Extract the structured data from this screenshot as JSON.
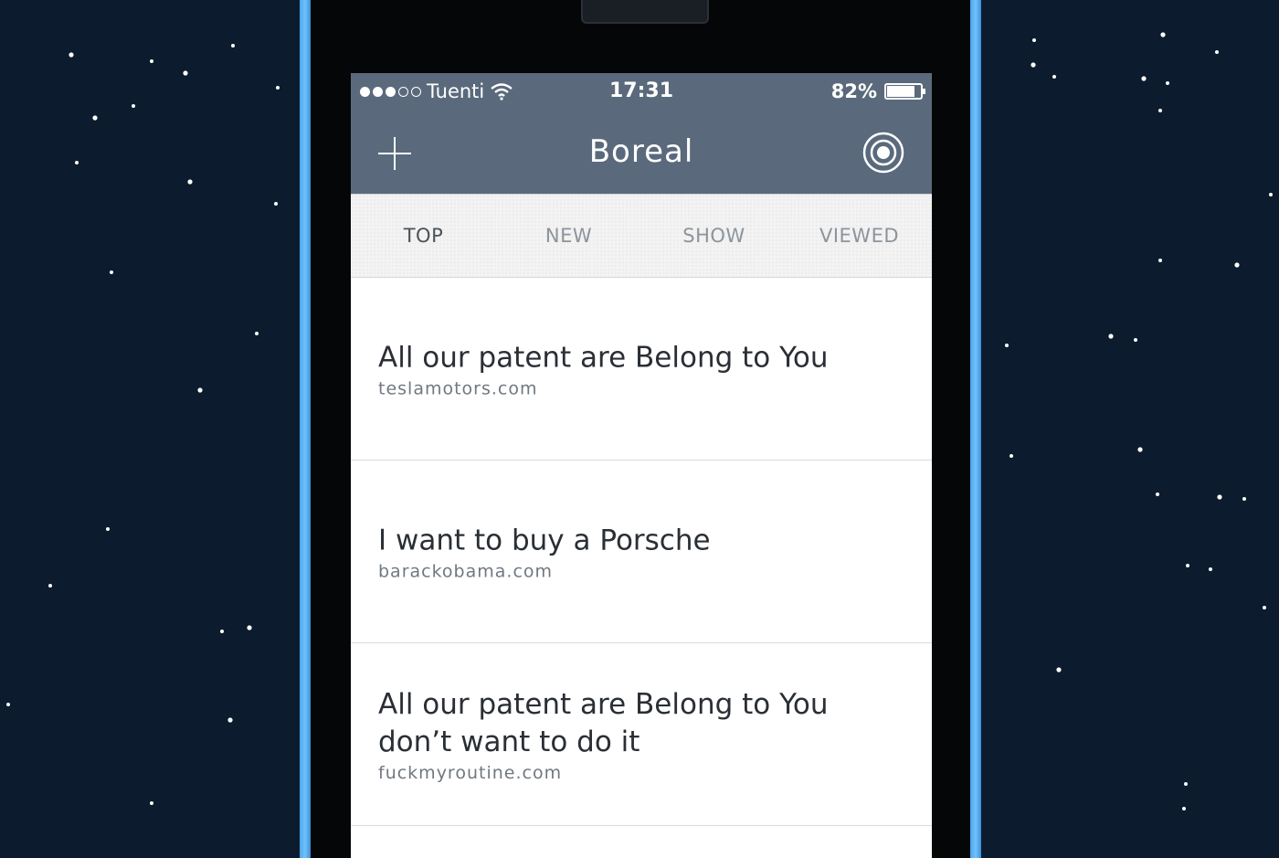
{
  "status_bar": {
    "signal_filled": 3,
    "signal_total": 5,
    "carrier": "Tuenti",
    "time": "17:31",
    "battery_percent_label": "82%",
    "battery_level": 0.82
  },
  "nav": {
    "title": "Boreal",
    "add_icon": "plus-icon",
    "right_icon": "target-icon"
  },
  "tabs": [
    {
      "label": "TOP",
      "active": true
    },
    {
      "label": "NEW",
      "active": false
    },
    {
      "label": "SHOW",
      "active": false
    },
    {
      "label": "VIEWED",
      "active": false
    }
  ],
  "stories": [
    {
      "title": "All our patent are Belong to You",
      "domain": "teslamotors.com"
    },
    {
      "title": "I want to buy a Porsche",
      "domain": "barackobama.com"
    },
    {
      "title": "All our patent are Belong to You don’t want to do it",
      "domain": "fuckmyroutine.com"
    }
  ],
  "colors": {
    "background": "#0d1b2e",
    "header": "#5a6a7c",
    "phone_edge": "#4da6e8"
  }
}
